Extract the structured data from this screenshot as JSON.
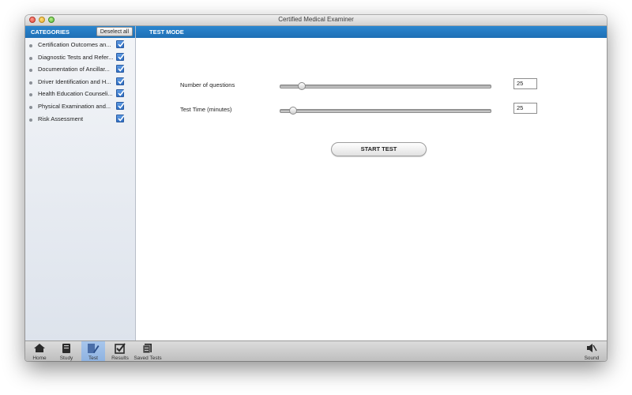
{
  "window": {
    "title": "Certified Medical Examiner"
  },
  "sidebar": {
    "header": "CATEGORIES",
    "deselect_label": "Deselect all",
    "items": [
      {
        "label": "Certification Outcomes an...",
        "checked": true
      },
      {
        "label": "Diagnostic Tests and Refer...",
        "checked": true
      },
      {
        "label": "Documentation of Ancillar...",
        "checked": true
      },
      {
        "label": "Driver Identification and H...",
        "checked": true
      },
      {
        "label": "Health Education Counseli...",
        "checked": true
      },
      {
        "label": "Physical Examination and...",
        "checked": true
      },
      {
        "label": "Risk Assessment",
        "checked": true
      }
    ]
  },
  "main": {
    "header": "TEST MODE",
    "questions": {
      "label": "Number of questions",
      "value": "25",
      "level": 0.1
    },
    "time": {
      "label": "Test Time (minutes)",
      "value": "25",
      "level": 0.06
    },
    "start_label": "START TEST"
  },
  "toolbar": {
    "home": "Home",
    "study": "Study",
    "test": "Test",
    "results": "Results",
    "saved": "Saved Tests",
    "sound": "Sound"
  },
  "colors": {
    "header_blue": "#1f74bb",
    "checkbox_blue": "#3a7bd5",
    "active_tab": "#9dbde8"
  }
}
